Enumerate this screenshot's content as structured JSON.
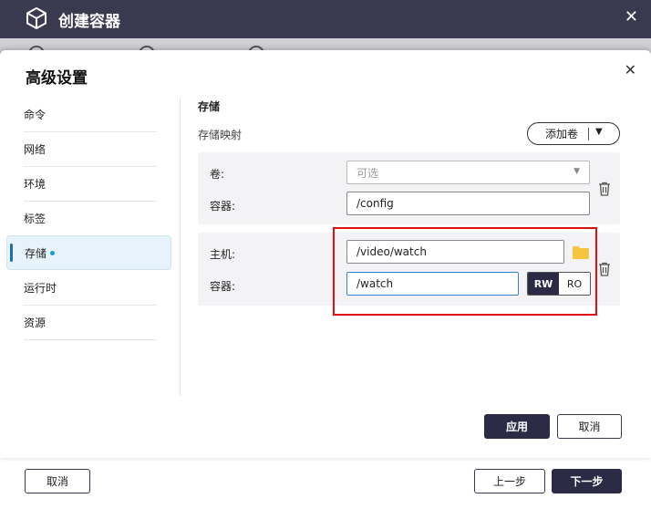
{
  "app": {
    "title": "创建容器",
    "close_icon": "close-icon",
    "logo_icon": "cube-icon"
  },
  "dialog": {
    "title": "高级设置",
    "close_icon": "close-icon",
    "apply_label": "应用",
    "cancel_label": "取消"
  },
  "sidebar": {
    "items": [
      {
        "label": "命令"
      },
      {
        "label": "网络"
      },
      {
        "label": "环境"
      },
      {
        "label": "标签"
      },
      {
        "label": "存储",
        "active": true
      },
      {
        "label": "运行时"
      },
      {
        "label": "资源"
      }
    ]
  },
  "storage": {
    "section_title": "存储",
    "mapping_label": "存储映射",
    "add_volume_label": "添加卷",
    "volume_card": {
      "volume_label": "卷:",
      "volume_placeholder": "可选",
      "container_label": "容器:",
      "container_value": "/config"
    },
    "bind_card": {
      "host_label": "主机:",
      "host_value": "/video/watch",
      "container_label": "容器:",
      "container_value": "/watch",
      "rw_label": "RW",
      "ro_label": "RO",
      "selected_mode": "RW"
    }
  },
  "footer": {
    "cancel_label": "取消",
    "prev_label": "上一步",
    "next_label": "下一步"
  },
  "colors": {
    "header_bg": "#3a3950",
    "primary_button": "#2c2b45",
    "active_tab_bg": "#e6f3fb",
    "highlight_border": "#e01010",
    "folder": "#f5c542"
  }
}
